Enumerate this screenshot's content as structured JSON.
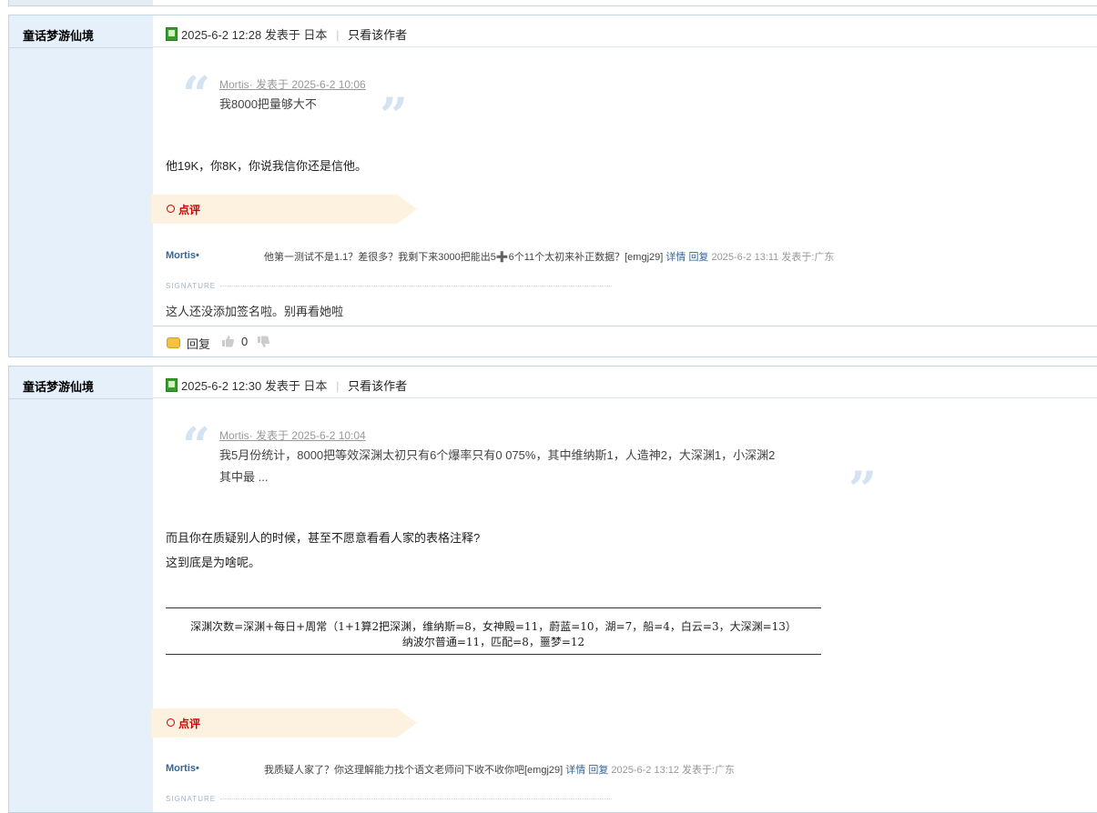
{
  "posts": [
    {
      "author": "童话梦游仙境",
      "datetime": "2025-6-2 12:28",
      "posted_from": "发表于 日本",
      "only_author": "只看该作者",
      "quote_source": "Mortis· 发表于 2025-6-2 10:06",
      "quote_lines": [
        "我8000把量够大不"
      ],
      "body_lines": [
        "他19K，你8K，你说我信你还是信他。"
      ],
      "comment_label": "点评",
      "comment_user": "Mortis•",
      "comment_text": "他第一测试不是1.1？差很多？我剩下来3000把能出5➕6个11个太初来补正数据？[emgj29]",
      "comment_detail": "详情",
      "comment_reply": "回复",
      "comment_time": "2025-6-2 13:11 发表于:广东",
      "signature_label": "SIGNATURE",
      "signature_text": "这人还没添加签名啦。别再看她啦",
      "reply_label": "回复",
      "like_count": "0"
    },
    {
      "author": "童话梦游仙境",
      "datetime": "2025-6-2 12:30",
      "posted_from": "发表于 日本",
      "only_author": "只看该作者",
      "quote_source": "Mortis· 发表于 2025-6-2 10:04",
      "quote_lines": [
        "我5月份统计，8000把等效深渊太初只有6个爆率只有0 075%，其中维纳斯1，人造神2，大深渊1，小深渊2",
        "其中最 ..."
      ],
      "body_lines": [
        "而且你在质疑别人的时候，甚至不愿意看看人家的表格注释?",
        "这到底是为啥呢。"
      ],
      "table_lines": [
        "深渊次数=深渊+每日+周常（1+1算2把深渊，维纳斯=8，女神殿=11，蔚蓝=10，湖=7，船=4，白云=3，大深渊=13）",
        "纳波尔普通=11，匹配=8，噩梦=12"
      ],
      "comment_label": "点评",
      "comment_user": "Mortis•",
      "comment_text": "我质疑人家了？你这理解能力找个语文老师问下收不收你吧[emgj29]",
      "comment_detail": "详情",
      "comment_reply": "回复",
      "comment_time": "2025-6-2 13:12 发表于:广东",
      "signature_label": "SIGNATURE"
    }
  ],
  "colors": {
    "sidebar": "#e5f0fb",
    "border": "#c2d5e3",
    "link": "#336699",
    "ribbon": "#fdf1df",
    "comment_label": "#cc0000"
  }
}
